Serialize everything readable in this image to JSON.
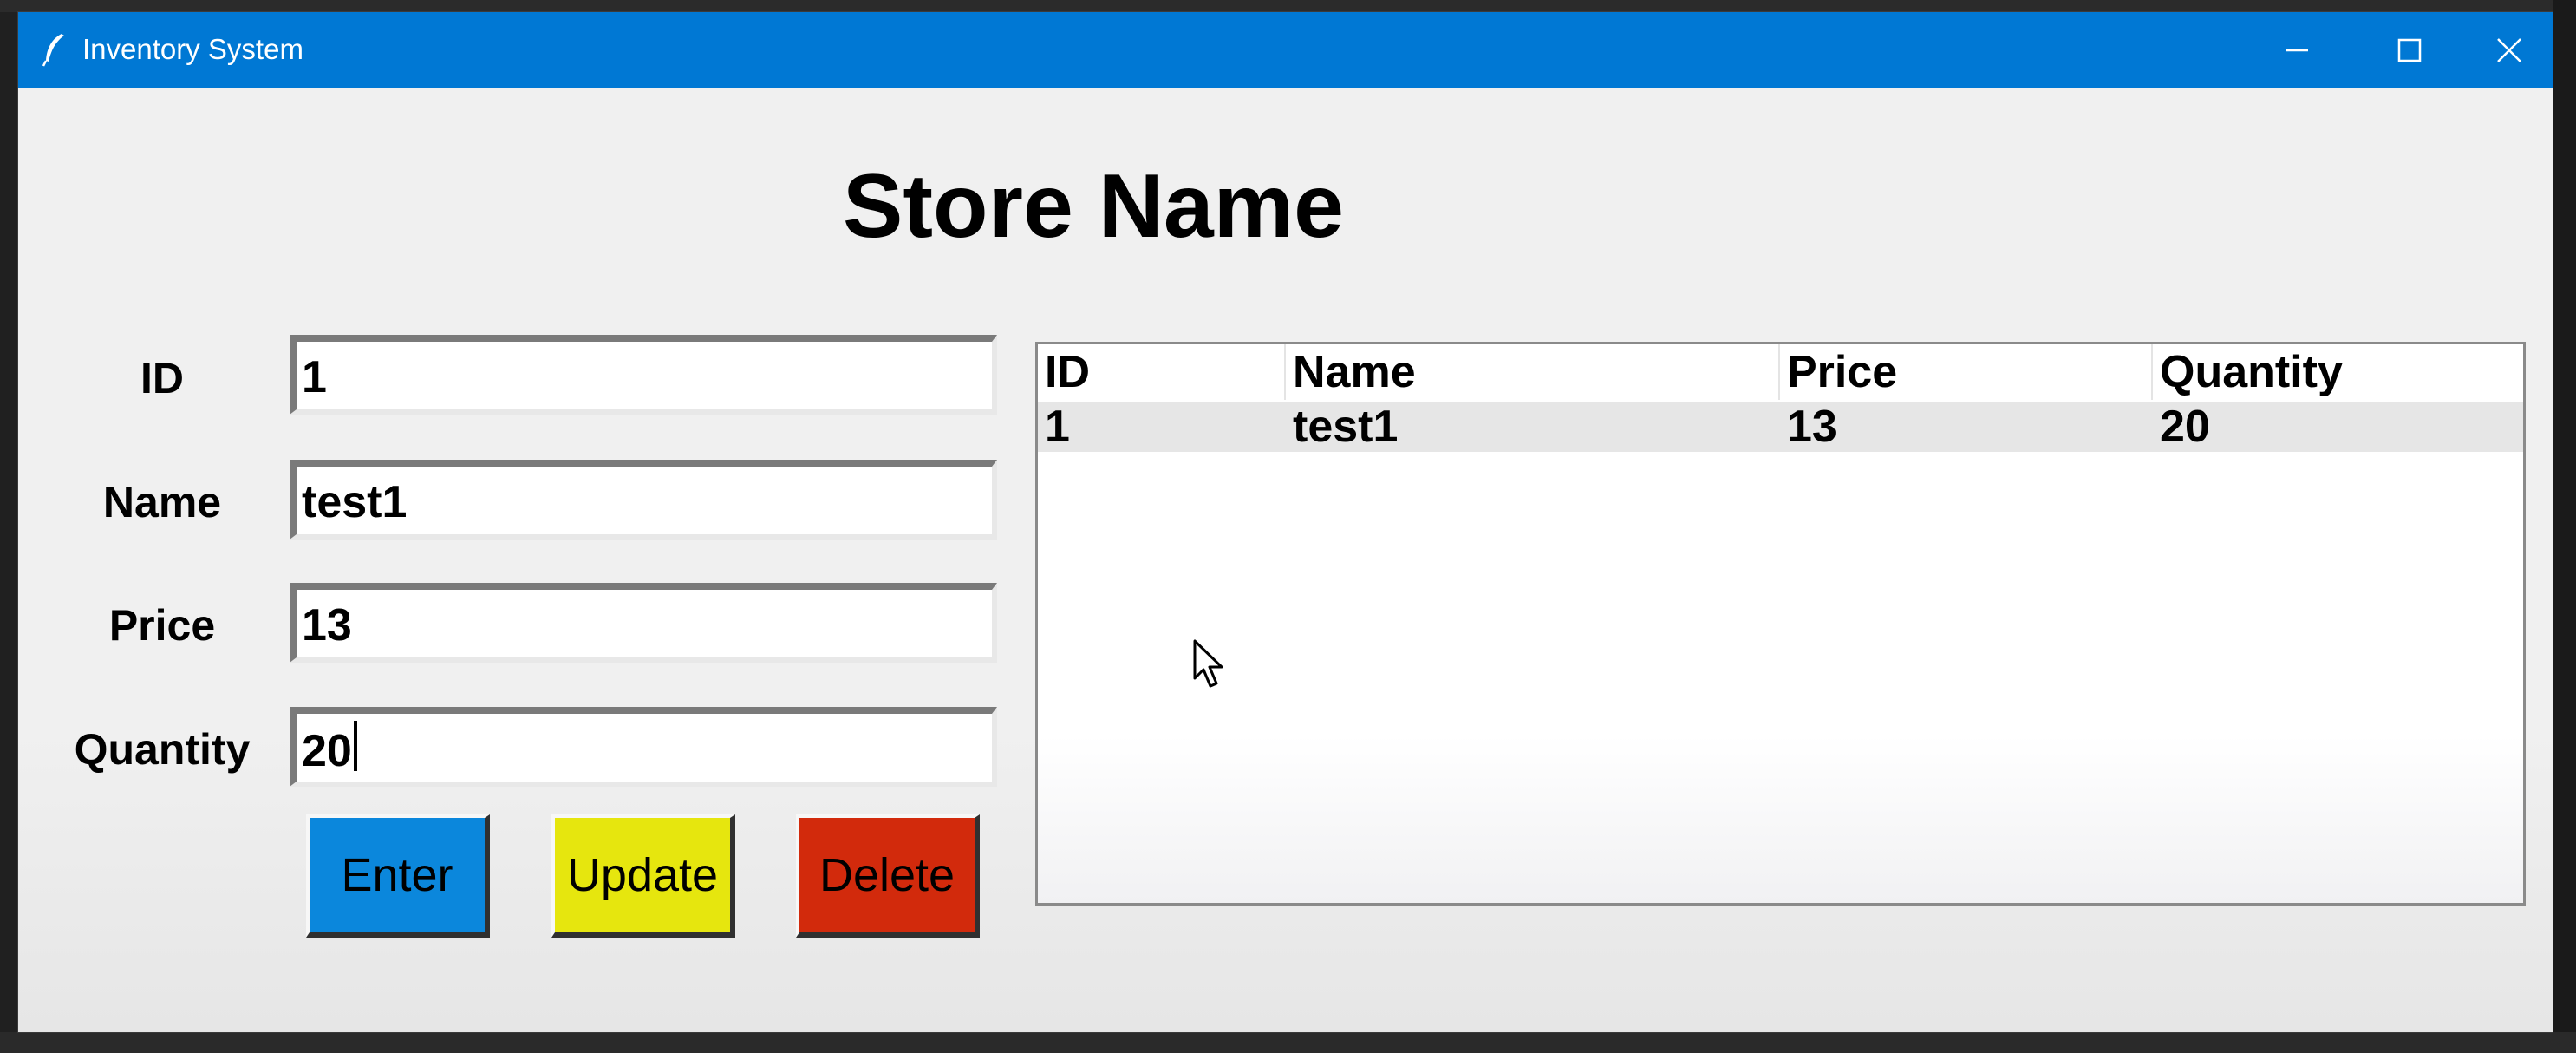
{
  "window": {
    "title": "Inventory System",
    "title_icon": "feather-icon",
    "controls": [
      "minimize-icon",
      "maximize-icon",
      "close-icon"
    ],
    "titlebar_color": "#0078d4"
  },
  "header": {
    "title": "Store Name"
  },
  "form": {
    "id_label": "ID",
    "id_value": "1",
    "name_label": "Name",
    "name_value": "test1",
    "price_label": "Price",
    "price_value": "13",
    "quantity_label": "Quantity",
    "quantity_value": "20"
  },
  "buttons": {
    "enter": {
      "label": "Enter",
      "color": "#0b87dc"
    },
    "update": {
      "label": "Update",
      "color": "#e6e60e"
    },
    "delete": {
      "label": "Delete",
      "color": "#d22a0c"
    }
  },
  "table": {
    "columns": [
      "ID",
      "Name",
      "Price",
      "Quantity"
    ],
    "rows": [
      [
        "1",
        "test1",
        "13",
        "20"
      ]
    ]
  }
}
